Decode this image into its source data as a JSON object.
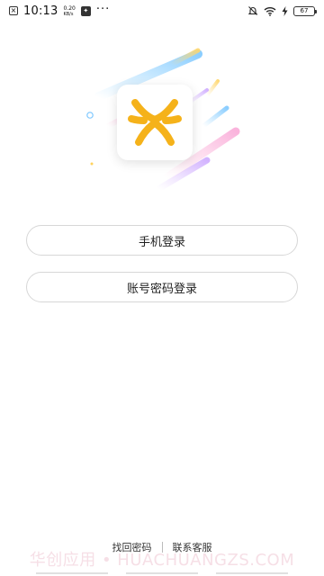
{
  "status_bar": {
    "time": "10:13",
    "net_speed_value": "0.20",
    "net_speed_unit": "KB/s",
    "more": "···",
    "battery_level": "67"
  },
  "brand": {
    "logo_icon": "asterisk-logo-icon",
    "accent_color": "#F5B21A"
  },
  "login": {
    "phone_login_label": "手机登录",
    "account_login_label": "账号密码登录"
  },
  "footer": {
    "forgot_password_label": "找回密码",
    "contact_service_label": "联系客服"
  },
  "watermark": {
    "text": "华创应用 • HUACHUANGZS.COM"
  }
}
